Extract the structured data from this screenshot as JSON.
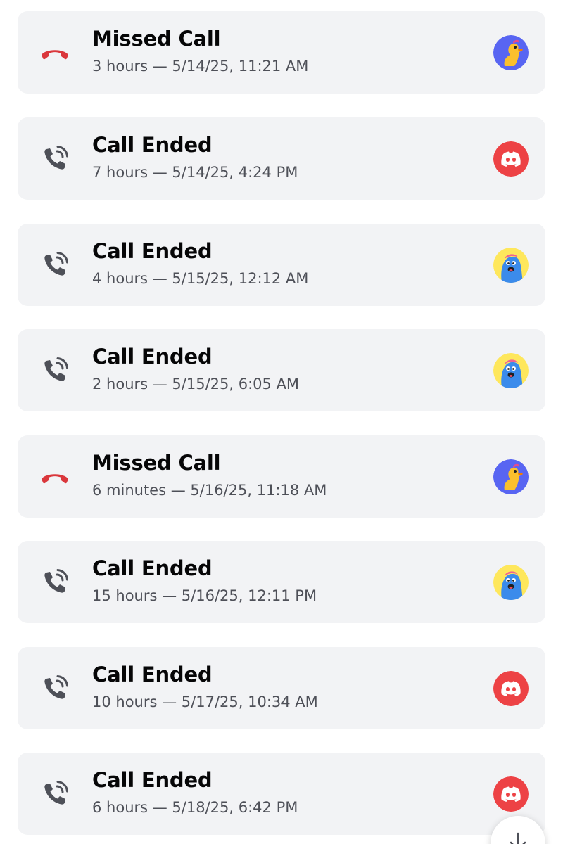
{
  "calls": [
    {
      "title": "Missed Call",
      "detail": "3 hours — 5/14/25, 11:21 AM",
      "status": "missed",
      "icon": "missed-call-icon",
      "avatar": "duck-avatar"
    },
    {
      "title": "Call Ended",
      "detail": "7 hours — 5/14/25, 4:24 PM",
      "status": "ended",
      "icon": "call-ended-icon",
      "avatar": "discord-avatar"
    },
    {
      "title": "Call Ended",
      "detail": "4 hours — 5/15/25, 12:12 AM",
      "status": "ended",
      "icon": "call-ended-icon",
      "avatar": "monster-avatar"
    },
    {
      "title": "Call Ended",
      "detail": "2 hours — 5/15/25, 6:05 AM",
      "status": "ended",
      "icon": "call-ended-icon",
      "avatar": "monster-avatar"
    },
    {
      "title": "Missed Call",
      "detail": "6 minutes — 5/16/25, 11:18 AM",
      "status": "missed",
      "icon": "missed-call-icon",
      "avatar": "duck-avatar"
    },
    {
      "title": "Call Ended",
      "detail": "15 hours — 5/16/25, 12:11 PM",
      "status": "ended",
      "icon": "call-ended-icon",
      "avatar": "monster-avatar"
    },
    {
      "title": "Call Ended",
      "detail": "10 hours — 5/17/25, 10:34 AM",
      "status": "ended",
      "icon": "call-ended-icon",
      "avatar": "discord-avatar"
    },
    {
      "title": "Call Ended",
      "detail": "6 hours — 5/18/25, 6:42 PM",
      "status": "ended",
      "icon": "call-ended-icon",
      "avatar": "discord-avatar"
    }
  ],
  "colors": {
    "card_bg": "#f2f3f5",
    "missed": "#da373c",
    "ended": "#4e5058",
    "discord_red": "#ed4245",
    "blurple": "#5865f2",
    "avatar_yellow": "#fee75c"
  },
  "scroll_button": {
    "icon": "arrow-down-icon"
  }
}
